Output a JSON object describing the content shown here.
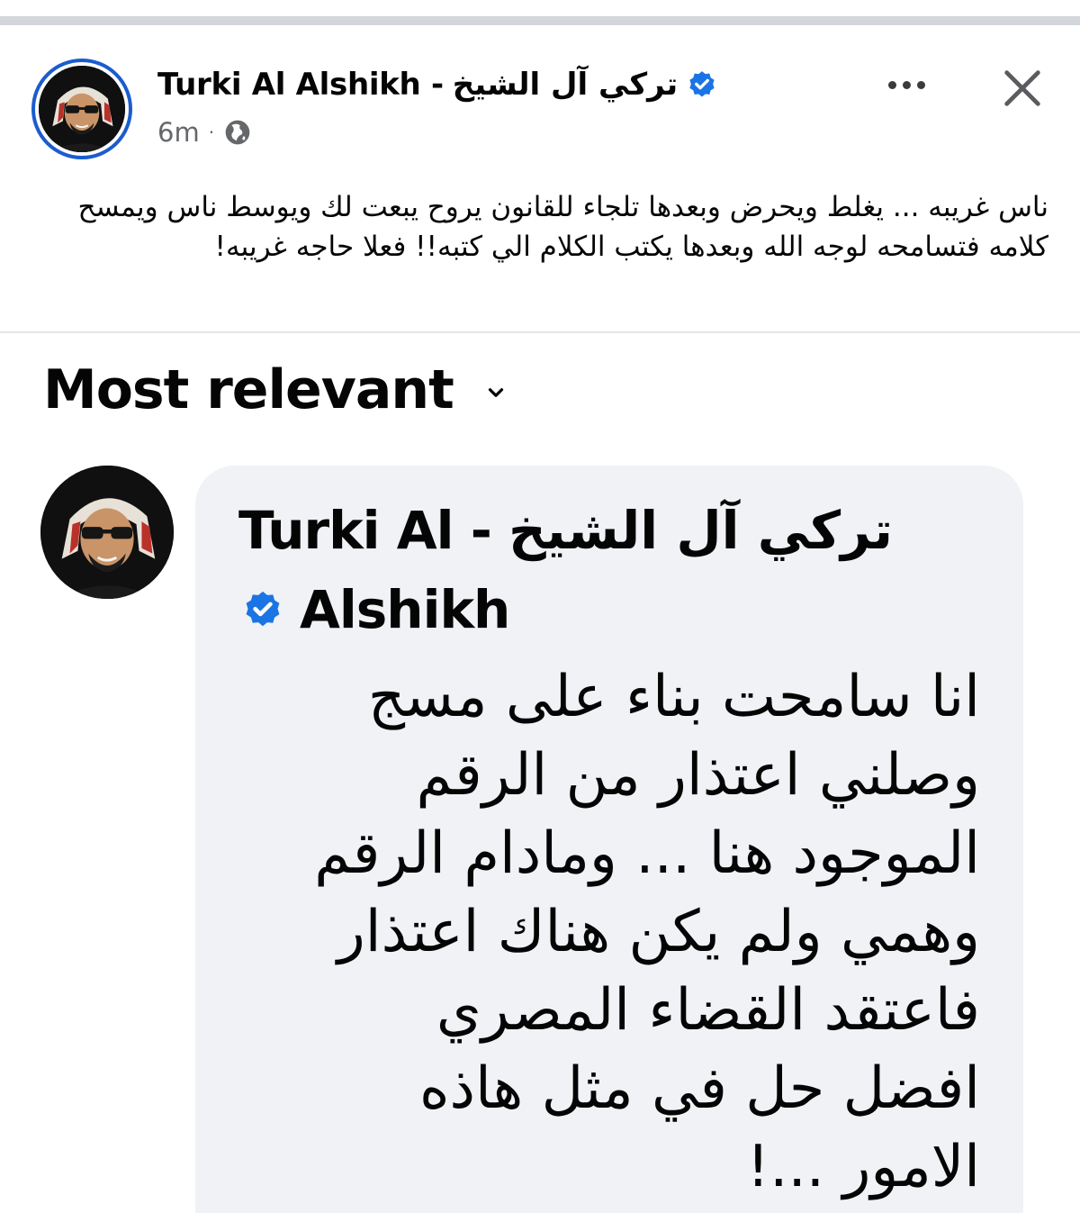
{
  "post": {
    "author_en": "Turki Al Alshikh -",
    "author_ar": "تركي آل الشيخ",
    "timestamp": "6m",
    "separator": "·",
    "audience_icon": "globe-icon",
    "more_icon": "more-horizontal-icon",
    "close_icon": "close-icon",
    "text": "ناس غريبه ... يغلط ويحرض وبعدها تلجاء للقانون يروح يبعت لك ويوسط ناس ويمسح كلامه فتسامحه لوجه الله وبعدها يكتب الكلام الي كتبه!! فعلا حاجه غريبه!"
  },
  "comments": {
    "sort_label": "Most relevant",
    "sort_icon": "chevron-down-icon",
    "items": [
      {
        "name_line1_en": "Turki Al -",
        "name_line1_ar": "تركي آل الشيخ",
        "name_line2": "Alshikh",
        "verified": true,
        "lines": [
          "انا سامحت بناء على مسج",
          "وصلني اعتذار من الرقم",
          "الموجود هنا ... ومادام الرقم",
          "وهمي ولم يكن هناك اعتذار",
          "فاعتقد القضاء المصري",
          "افضل حل في مثل هاذه",
          "الامور ...!"
        ]
      }
    ]
  },
  "colors": {
    "verified_blue": "#1b74e4",
    "avatar_ring": "#1b5ccf",
    "bubble_bg": "#f0f2f5",
    "meta_text": "#65676b"
  }
}
